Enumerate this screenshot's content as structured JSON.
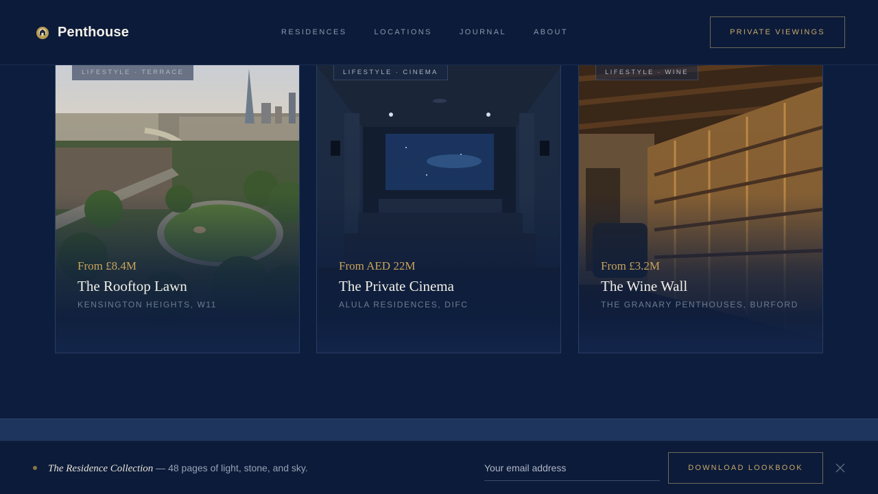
{
  "brand": {
    "name": "Penthouse",
    "logo_icon": "house-emblem-icon"
  },
  "nav": {
    "items": [
      "RESIDENCES",
      "LOCATIONS",
      "JOURNAL",
      "ABOUT"
    ]
  },
  "header_cta": "PRIVATE VIEWINGS",
  "cards": [
    {
      "tag": "LIFESTYLE · TERRACE",
      "price": "From £8.4M",
      "title": "The Rooftop Lawn",
      "location": "KENSINGTON HEIGHTS, W11"
    },
    {
      "tag": "LIFESTYLE · CINEMA",
      "price": "From AED 22M",
      "title": "The Private Cinema",
      "location": "ALULA RESIDENCES, DIFC"
    },
    {
      "tag": "LIFESTYLE · WINE",
      "price": "From £3.2M",
      "title": "The Wine Wall",
      "location": "THE GRANARY PENTHOUSES, BURFORD"
    }
  ],
  "lookbook": {
    "name": "The Residence Collection",
    "rest": " — 48 pages of light, stone, and sky.",
    "email_placeholder": "Your email address",
    "button": "DOWNLOAD LOOKBOOK",
    "close_icon": "close-icon"
  },
  "colors": {
    "navy": "#0d1d3d",
    "gold": "#c8a35a",
    "band": "#1e365e"
  }
}
